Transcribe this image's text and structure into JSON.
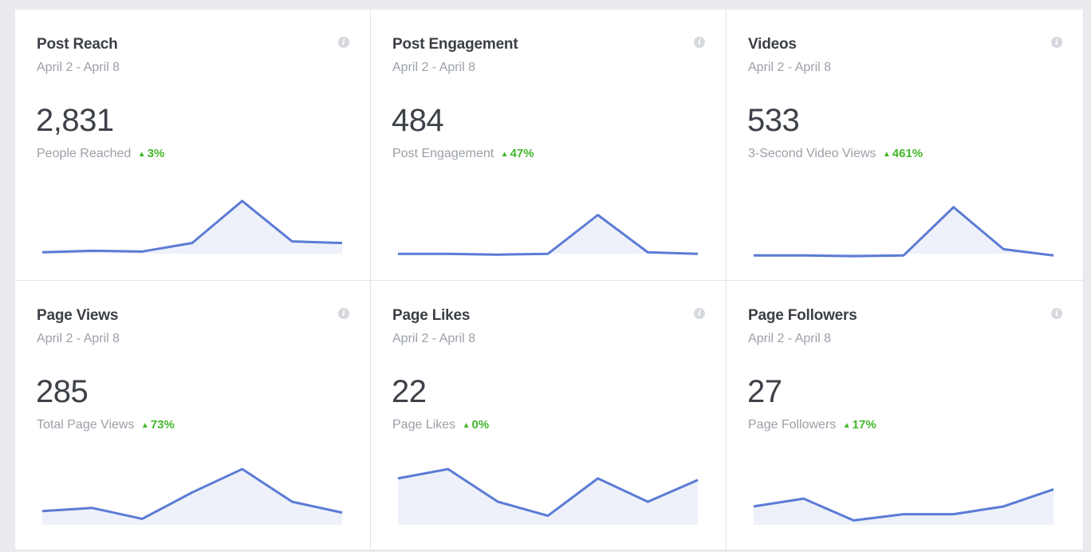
{
  "cards": [
    {
      "title": "Post Reach",
      "date": "April 2 - April 8",
      "value": "2,831",
      "label": "People Reached",
      "change": "3%",
      "sparkline": [
        12,
        14,
        13,
        24,
        78,
        26,
        24
      ]
    },
    {
      "title": "Post Engagement",
      "date": "April 2 - April 8",
      "value": "484",
      "label": "Post Engagement",
      "change": "47%",
      "sparkline": [
        10,
        10,
        9,
        10,
        60,
        12,
        10
      ]
    },
    {
      "title": "Videos",
      "date": "April 2 - April 8",
      "value": "533",
      "label": "3-Second Video Views",
      "change": "461%",
      "sparkline": [
        8,
        8,
        7,
        8,
        70,
        16,
        8
      ]
    },
    {
      "title": "Page Views",
      "date": "April 2 - April 8",
      "value": "285",
      "label": "Total Page Views",
      "change": "73%",
      "sparkline": [
        28,
        32,
        18,
        52,
        82,
        40,
        26
      ]
    },
    {
      "title": "Page Likes",
      "date": "April 2 - April 8",
      "value": "22",
      "label": "Page Likes",
      "change": "0%",
      "sparkline": [
        70,
        82,
        40,
        22,
        70,
        40,
        68
      ]
    },
    {
      "title": "Page Followers",
      "date": "April 2 - April 8",
      "value": "27",
      "label": "Page Followers",
      "change": "17%",
      "sparkline": [
        34,
        44,
        16,
        24,
        24,
        34,
        56
      ]
    }
  ],
  "colors": {
    "line": "#5b7bd5",
    "fill": "#eef1f9",
    "trend_up": "#42b72a"
  },
  "icons": {
    "info": "info-icon",
    "trend_up": "triangle-up-icon"
  }
}
